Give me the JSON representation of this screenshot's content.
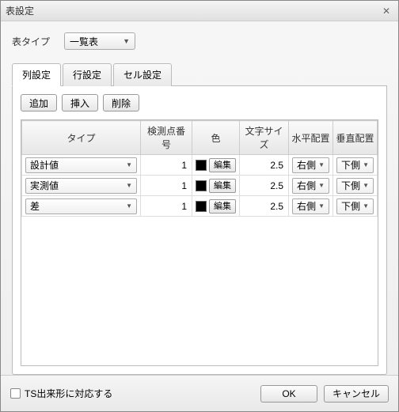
{
  "title": "表設定",
  "tableType": {
    "label": "表タイプ",
    "value": "一覧表"
  },
  "tabs": [
    "列設定",
    "行設定",
    "セル設定"
  ],
  "activeTab": 0,
  "toolbar": {
    "add": "追加",
    "insert": "挿入",
    "delete": "削除"
  },
  "columns": {
    "type": "タイプ",
    "pointNo": "検測点番号",
    "color": "色",
    "fontSize": "文字サイズ",
    "halign": "水平配置",
    "valign": "垂直配置"
  },
  "colorEditLabel": "編集",
  "rows": [
    {
      "type": "設計値",
      "pointNo": 1,
      "colorHex": "#000000",
      "fontSize": "2.5",
      "halign": "右側",
      "valign": "下側"
    },
    {
      "type": "実測値",
      "pointNo": 1,
      "colorHex": "#000000",
      "fontSize": "2.5",
      "halign": "右側",
      "valign": "下側"
    },
    {
      "type": "差",
      "pointNo": 1,
      "colorHex": "#000000",
      "fontSize": "2.5",
      "halign": "右側",
      "valign": "下側"
    }
  ],
  "checkbox": {
    "label": "TS出来形に対応する",
    "checked": false
  },
  "buttons": {
    "ok": "OK",
    "cancel": "キャンセル"
  }
}
